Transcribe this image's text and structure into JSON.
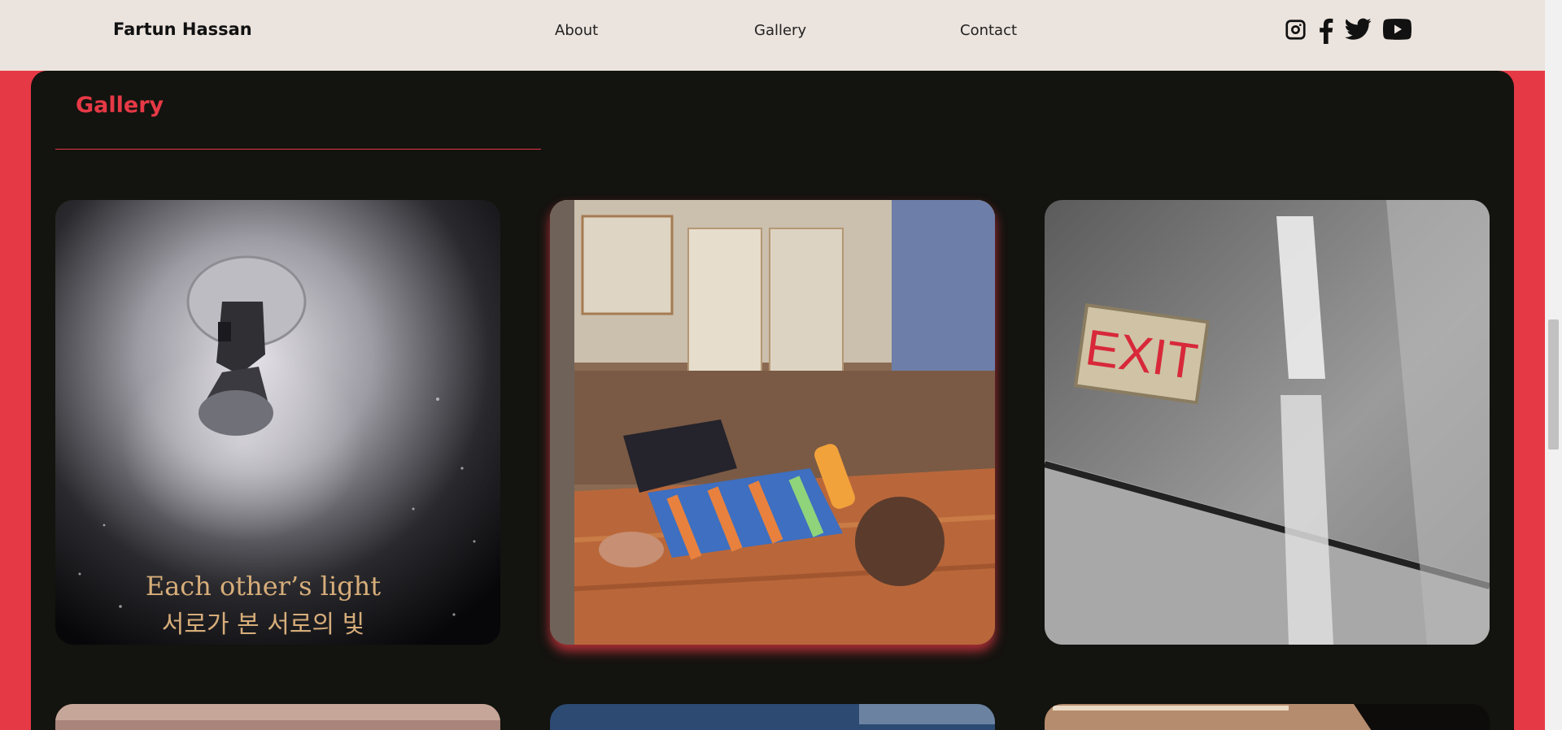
{
  "header": {
    "brand": "Fartun Hassan",
    "nav": {
      "about": "About",
      "gallery": "Gallery",
      "contact": "Contact"
    },
    "social_icons": [
      "instagram-icon",
      "facebook-icon",
      "twitter-icon",
      "youtube-icon"
    ]
  },
  "gallery": {
    "title": "Gallery",
    "items": [
      {
        "caption_en": "Each other’s light",
        "caption_ko": "서로가 본 서로의 빛"
      },
      {},
      {}
    ]
  },
  "colors": {
    "accent": "#e63946",
    "header_bg": "#ebe3dd",
    "panel_bg": "#13130f"
  }
}
